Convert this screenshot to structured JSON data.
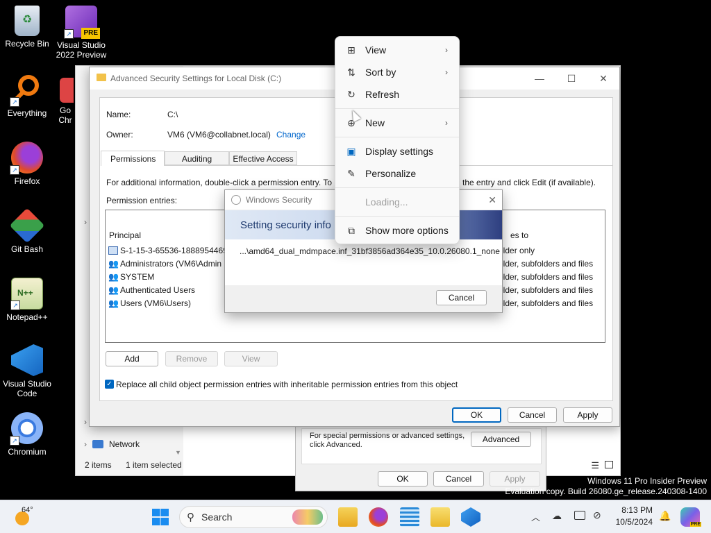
{
  "desktop": {
    "icons": [
      {
        "label": "Recycle Bin"
      },
      {
        "label": "Visual Studio 2022 Preview"
      },
      {
        "label": "Everything"
      },
      {
        "label": "Firefox"
      },
      {
        "label": "Git Bash"
      },
      {
        "label": "Notepad++"
      },
      {
        "label": "Visual Studio Code"
      },
      {
        "label": "Chromium"
      }
    ],
    "vs_badge": "PRE",
    "partial_icon_label": "Go Chr"
  },
  "explorer": {
    "nav_item": "Network",
    "status_items": "2 items",
    "status_selected": "1 item selected"
  },
  "properties": {
    "special_text": "For special permissions or advanced settings, click Advanced.",
    "advanced_button": "Advanced",
    "ok": "OK",
    "cancel": "Cancel",
    "apply": "Apply"
  },
  "advanced_security": {
    "title": "Advanced Security Settings for Local Disk (C:)",
    "name_label": "Name:",
    "name_value": "C:\\",
    "owner_label": "Owner:",
    "owner_value": "VM6 (VM6@collabnet.local)",
    "change_link": "Change",
    "tabs": [
      "Permissions",
      "Auditing",
      "Effective Access"
    ],
    "info_left": "For additional information, double-click a permission entry. To",
    "info_right": "the entry and click Edit (if available).",
    "entries_label": "Permission entries:",
    "col_principal": "Principal",
    "col_applies_tail": "es to",
    "rows": [
      {
        "principal": "S-1-15-3-65536-1888954469-",
        "applies": "older only"
      },
      {
        "principal": "Administrators (VM6\\Admin",
        "applies": "older, subfolders and files"
      },
      {
        "principal": "SYSTEM",
        "applies": "older, subfolders and files"
      },
      {
        "principal": "Authenticated Users",
        "applies": "older, subfolders and files"
      },
      {
        "principal": "Users (VM6\\Users)",
        "applies": "older, subfolders and files"
      }
    ],
    "add": "Add",
    "remove": "Remove",
    "view": "View",
    "replace_checkbox": "Replace all child object permission entries with inheritable permission entries from this object",
    "ok": "OK",
    "cancel": "Cancel",
    "apply": "Apply"
  },
  "windows_security": {
    "title": "Windows Security",
    "heading": "Setting security info",
    "path": "...\\amd64_dual_mdmpace.inf_31bf3856ad364e35_10.0.26080.1_none",
    "cancel": "Cancel"
  },
  "context_menu": {
    "items": [
      {
        "label": "View",
        "icon": "grid-icon",
        "submenu": true
      },
      {
        "label": "Sort by",
        "icon": "sort-icon",
        "submenu": true
      },
      {
        "label": "Refresh",
        "icon": "refresh-icon",
        "submenu": false
      },
      {
        "label": "New",
        "icon": "new-icon",
        "submenu": true
      },
      {
        "label": "Display settings",
        "icon": "display-icon",
        "submenu": false
      },
      {
        "label": "Personalize",
        "icon": "brush-icon",
        "submenu": false
      },
      {
        "label": "Loading...",
        "icon": "",
        "submenu": false
      },
      {
        "label": "Show more options",
        "icon": "more-options-icon",
        "submenu": false
      }
    ]
  },
  "taskbar": {
    "weather_temp": "64°",
    "search_placeholder": "Search",
    "time": "8:13 PM",
    "date": "10/5/2024"
  },
  "watermark": {
    "line1": "Windows 11 Pro Insider Preview",
    "line2": "Evaluation copy. Build 26080.ge_release.240308-1400"
  },
  "colors": {
    "accent": "#0067c0",
    "link": "#0066cc"
  }
}
